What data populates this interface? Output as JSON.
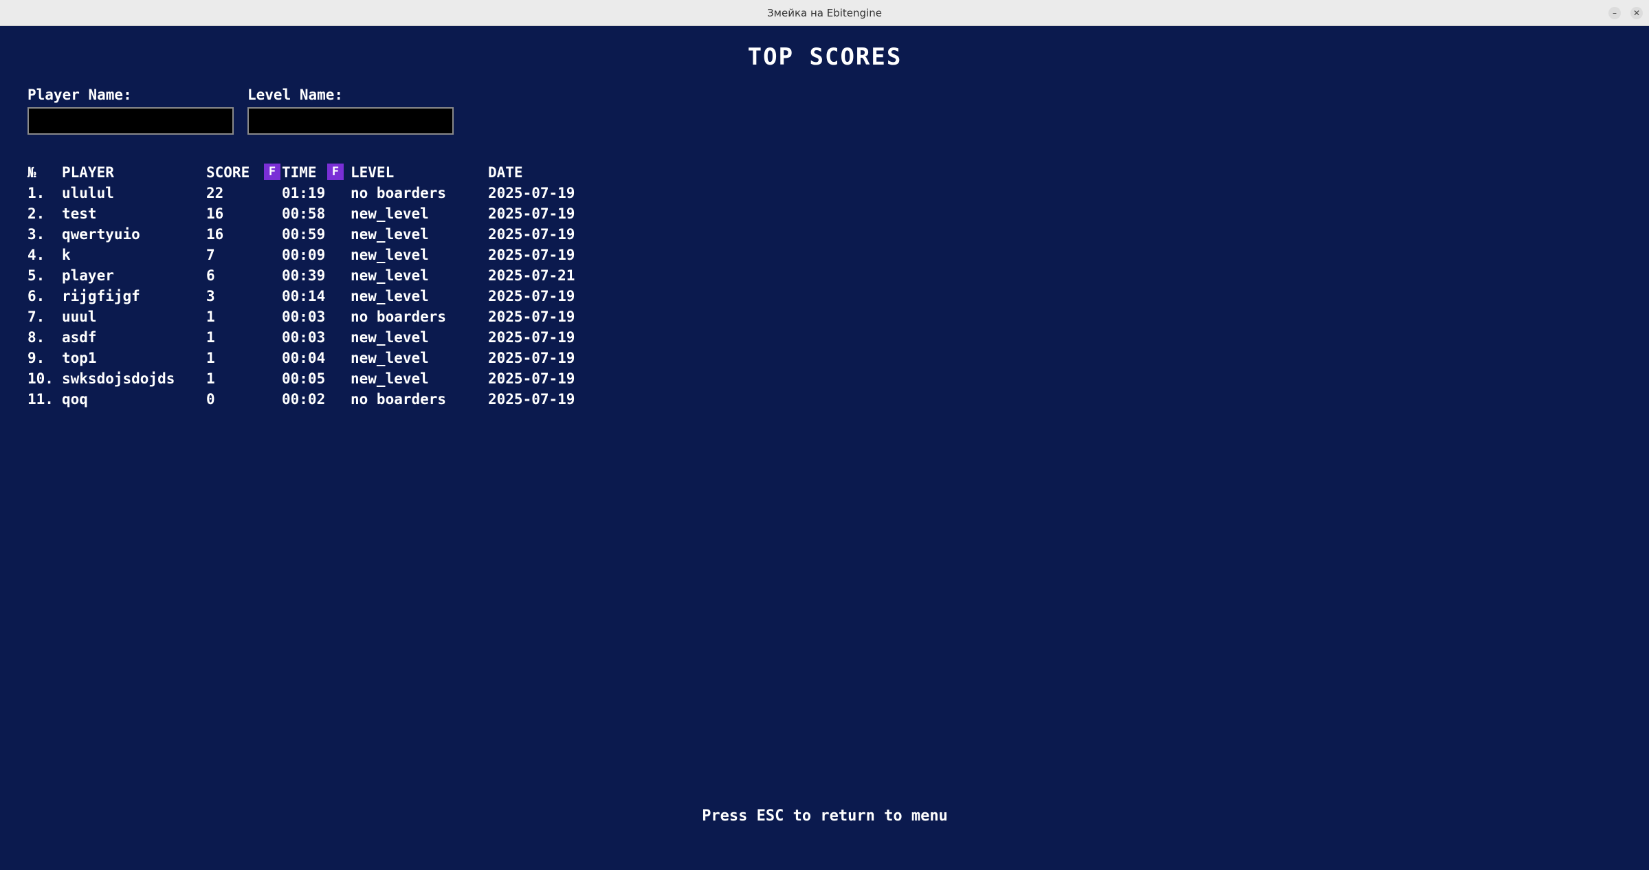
{
  "window": {
    "title": "Змейка на Ebitengine",
    "minimize_glyph": "–",
    "close_glyph": "✕"
  },
  "screen": {
    "heading": "TOP SCORES",
    "filters": {
      "player_label": "Player Name:",
      "player_value": "",
      "level_label": "Level Name:",
      "level_value": ""
    },
    "table": {
      "headers": {
        "num": "№",
        "player": "PLAYER",
        "score": "SCORE",
        "score_filter": "F",
        "time": "TIME",
        "time_filter": "F",
        "level": "LEVEL",
        "date": "DATE"
      },
      "rows": [
        {
          "num": "1.",
          "player": "ululul",
          "score": "22",
          "time": "01:19",
          "level": "no boarders",
          "date": "2025-07-19"
        },
        {
          "num": "2.",
          "player": "test",
          "score": "16",
          "time": "00:58",
          "level": "new_level",
          "date": "2025-07-19"
        },
        {
          "num": "3.",
          "player": "qwertyuio",
          "score": "16",
          "time": "00:59",
          "level": "new_level",
          "date": "2025-07-19"
        },
        {
          "num": "4.",
          "player": "k",
          "score": "7",
          "time": "00:09",
          "level": "new_level",
          "date": "2025-07-19"
        },
        {
          "num": "5.",
          "player": "player",
          "score": "6",
          "time": "00:39",
          "level": "new_level",
          "date": "2025-07-21"
        },
        {
          "num": "6.",
          "player": "rijgfijgf",
          "score": "3",
          "time": "00:14",
          "level": "new_level",
          "date": "2025-07-19"
        },
        {
          "num": "7.",
          "player": "uuul",
          "score": "1",
          "time": "00:03",
          "level": "no boarders",
          "date": "2025-07-19"
        },
        {
          "num": "8.",
          "player": "asdf",
          "score": "1",
          "time": "00:03",
          "level": "new_level",
          "date": "2025-07-19"
        },
        {
          "num": "9.",
          "player": "top1",
          "score": "1",
          "time": "00:04",
          "level": "new_level",
          "date": "2025-07-19"
        },
        {
          "num": "10.",
          "player": "swksdojsdojds",
          "score": "1",
          "time": "00:05",
          "level": "new_level",
          "date": "2025-07-19"
        },
        {
          "num": "11.",
          "player": "qoq",
          "score": "0",
          "time": "00:02",
          "level": "no boarders",
          "date": "2025-07-19"
        }
      ]
    },
    "footer": "Press ESC to return to menu"
  },
  "colors": {
    "background": "#0b1a4e",
    "text": "#ffffff",
    "filter_button": "#7a2fd6",
    "input_background": "#000000"
  }
}
